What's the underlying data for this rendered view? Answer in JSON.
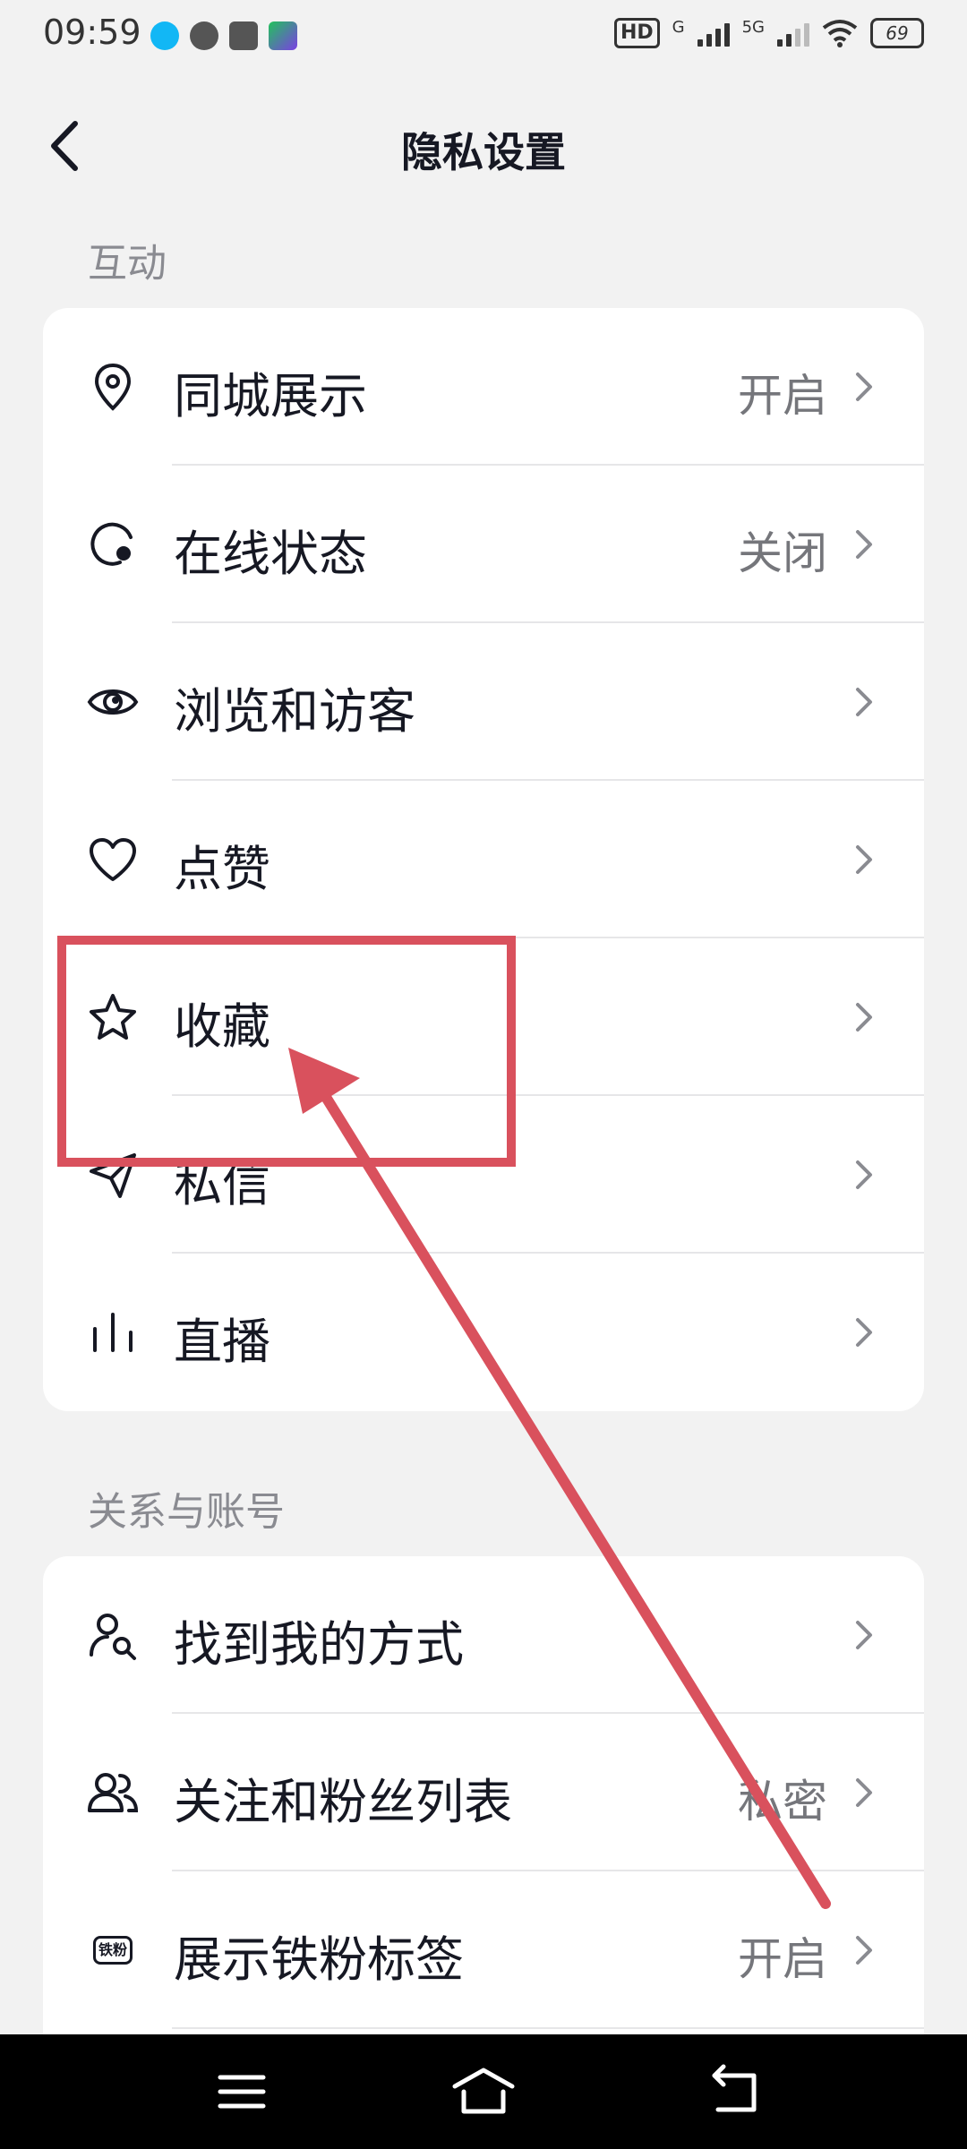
{
  "status_bar": {
    "time": "09:59",
    "hd_label": "HD",
    "network_1": "G",
    "network_2": "5G",
    "battery": "69"
  },
  "header": {
    "title": "隐私设置",
    "back_icon": "chevron-left-icon"
  },
  "sections": [
    {
      "title": "互动",
      "items": [
        {
          "label": "同城展示",
          "value": "开启",
          "icon": "location-pin-icon"
        },
        {
          "label": "在线状态",
          "value": "关闭",
          "icon": "online-status-icon"
        },
        {
          "label": "浏览和访客",
          "value": "",
          "icon": "eye-icon"
        },
        {
          "label": "点赞",
          "value": "",
          "icon": "heart-icon"
        },
        {
          "label": "收藏",
          "value": "",
          "icon": "star-icon"
        },
        {
          "label": "私信",
          "value": "",
          "icon": "paper-plane-icon"
        },
        {
          "label": "直播",
          "value": "",
          "icon": "live-bars-icon"
        }
      ]
    },
    {
      "title": "关系与账号",
      "items": [
        {
          "label": "找到我的方式",
          "value": "",
          "icon": "find-user-icon"
        },
        {
          "label": "关注和粉丝列表",
          "value": "私密",
          "icon": "users-icon"
        },
        {
          "label": "展示铁粉标签",
          "value": "开启",
          "icon": "fan-badge-icon",
          "badge_text": "铁粉"
        }
      ]
    }
  ],
  "annotation": {
    "color": "#d9515d"
  },
  "system_nav": {
    "menu_icon": "menu-icon",
    "home_icon": "home-icon",
    "back_icon": "back-arrow-icon"
  }
}
